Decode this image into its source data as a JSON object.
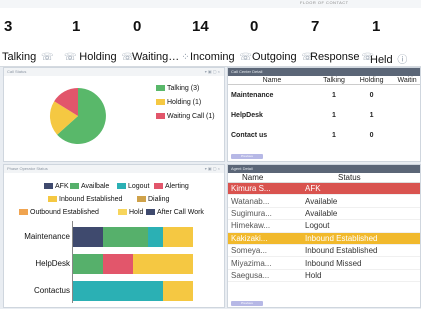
{
  "topbar": {
    "caption": "FLOOR OF CONTACT"
  },
  "stats": [
    {
      "value": "3",
      "label": "Talking",
      "icon": "phone-icon"
    },
    {
      "value": "1",
      "label": "Holding",
      "icon": "phone-icon"
    },
    {
      "value": "0",
      "label": "Waiting…",
      "icon": "phone-wave-icon"
    },
    {
      "value": "14",
      "label": "Incoming",
      "icon": "phone-in-icon"
    },
    {
      "value": "0",
      "label": "Outgoing",
      "icon": "phone-out-icon"
    },
    {
      "value": "7",
      "label": "Response",
      "icon": "phone-reply-icon"
    },
    {
      "value": "1",
      "label": "Held",
      "icon": "info-icon"
    }
  ],
  "call_status": {
    "header": "Call Status",
    "legend": [
      {
        "label": "Talking (3)",
        "color": "#59b86a"
      },
      {
        "label": "Holding (1)",
        "color": "#f5c842"
      },
      {
        "label": "Waiting Call (1)",
        "color": "#e2566b"
      }
    ]
  },
  "call_center": {
    "header": "Call Center Detail",
    "columns": [
      "Name",
      "Talking",
      "Holding",
      "Waitin"
    ],
    "rows": [
      {
        "name": "Maintenance",
        "talking": "1",
        "holding": "0"
      },
      {
        "name": "HelpDesk",
        "talking": "1",
        "holding": "1"
      },
      {
        "name": "Contact us",
        "talking": "1",
        "holding": "0"
      }
    ],
    "button": "Previous"
  },
  "operator_status": {
    "header": "Phase Operator Status",
    "legend": [
      {
        "label": "AFK",
        "color": "#3f4a6e"
      },
      {
        "label": "Availbale",
        "color": "#56b06b"
      },
      {
        "label": "Logout",
        "color": "#2bb0b4"
      },
      {
        "label": "Alerting",
        "color": "#e2566b"
      },
      {
        "label": "Inbound Established",
        "color": "#f5c842"
      },
      {
        "label": "Dialing",
        "color": "#cfa24a"
      },
      {
        "label": "Outbound Established",
        "color": "#f0a450"
      },
      {
        "label": "Hold",
        "color": "#f7d55c"
      },
      {
        "label": "After Call Work",
        "color": "#3f4a6e"
      }
    ],
    "rows": [
      "Maintenance",
      "HelpDesk",
      "Contactus"
    ]
  },
  "chart_data": {
    "type": "bar",
    "stacked": true,
    "orientation": "horizontal",
    "categories": [
      "Maintenance",
      "HelpDesk",
      "Contactus"
    ],
    "series": [
      {
        "name": "AFK",
        "color": "#3f4a6e",
        "values": [
          1,
          0,
          0
        ]
      },
      {
        "name": "Availbale",
        "color": "#56b06b",
        "values": [
          1.5,
          1,
          0
        ]
      },
      {
        "name": "Logout",
        "color": "#2bb0b4",
        "values": [
          0.5,
          0,
          3
        ]
      },
      {
        "name": "Alerting",
        "color": "#e2566b",
        "values": [
          0,
          1,
          0
        ]
      },
      {
        "name": "Inbound Established",
        "color": "#f5c842",
        "values": [
          1,
          2,
          1
        ]
      }
    ]
  },
  "agent_detail": {
    "header": "Agent Detail",
    "columns": [
      "Name",
      "Status"
    ],
    "rows": [
      {
        "name": "Kimura S...",
        "status": "AFK",
        "highlight": "red"
      },
      {
        "name": "Watanab...",
        "status": "Available",
        "highlight": ""
      },
      {
        "name": "Sugimura...",
        "status": "Available",
        "highlight": ""
      },
      {
        "name": "Himekaw...",
        "status": "Logout",
        "highlight": ""
      },
      {
        "name": "Kakizaki...",
        "status": "Inbound Established",
        "highlight": "yel"
      },
      {
        "name": "Someya...",
        "status": "Inbound Established",
        "highlight": ""
      },
      {
        "name": "Miyazima...",
        "status": "Inbound Missed",
        "highlight": ""
      },
      {
        "name": "Saegusa...",
        "status": "Hold",
        "highlight": ""
      }
    ],
    "button": "Previous"
  }
}
